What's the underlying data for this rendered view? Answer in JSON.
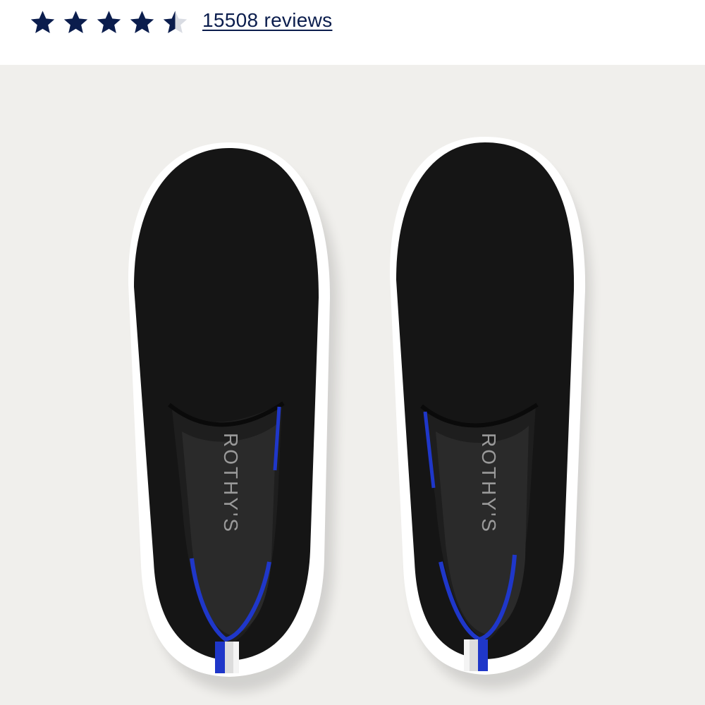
{
  "rating": {
    "value": 4.5,
    "max": 5,
    "star_color": "#0b1d4d",
    "empty_star_color": "#d9dce3",
    "reviews_label": "15508 reviews"
  },
  "product_image": {
    "brand_text": "ROTHY'S",
    "background_color": "#f0efec",
    "shoe_color": "#151515",
    "sole_color": "#ffffff",
    "accent_color": "#1f37c9"
  }
}
